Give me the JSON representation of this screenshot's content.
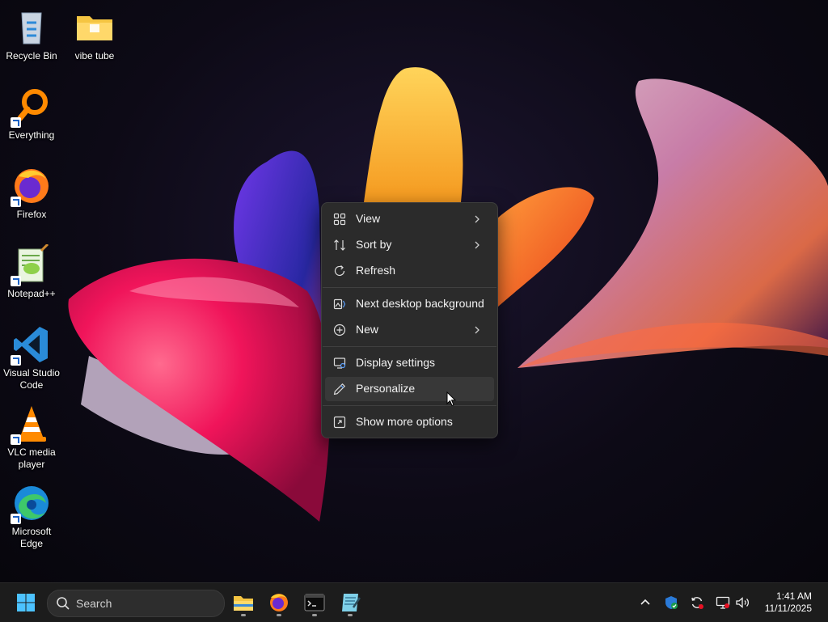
{
  "desktop": {
    "icons": [
      {
        "label": "Recycle Bin"
      },
      {
        "label": "vibe tube"
      },
      {
        "label": "Everything"
      },
      {
        "label": "Firefox"
      },
      {
        "label": "Notepad++"
      },
      {
        "label": "Visual Studio Code"
      },
      {
        "label": "VLC media player"
      },
      {
        "label": "Microsoft Edge"
      }
    ]
  },
  "context_menu": {
    "items": [
      {
        "label": "View",
        "icon": "grid-view-icon",
        "submenu": true
      },
      {
        "label": "Sort by",
        "icon": "sort-icon",
        "submenu": true
      },
      {
        "label": "Refresh",
        "icon": "refresh-icon",
        "submenu": false
      },
      {
        "label": "Next desktop background",
        "icon": "next-background-icon",
        "submenu": false
      },
      {
        "label": "New",
        "icon": "new-plus-icon",
        "submenu": true
      },
      {
        "label": "Display settings",
        "icon": "display-settings-icon",
        "submenu": false
      },
      {
        "label": "Personalize",
        "icon": "pen-icon",
        "submenu": false,
        "hovered": true
      },
      {
        "label": "Show more options",
        "icon": "more-options-icon",
        "submenu": false
      }
    ]
  },
  "taskbar": {
    "search_placeholder": "Search",
    "pinned": [
      "file-explorer-icon",
      "firefox-icon",
      "terminal-icon",
      "notepad-app-icon"
    ],
    "tray": [
      "chevron-up-icon",
      "defender-icon",
      "sync-icon",
      "network-icon",
      "volume-icon"
    ],
    "clock": {
      "time": "1:41 AM",
      "date": "11/11/2025"
    }
  },
  "colors": {
    "menu_bg": "#2b2b2b",
    "taskbar_bg": "#1c1c1c",
    "accent": "#0078d4"
  }
}
